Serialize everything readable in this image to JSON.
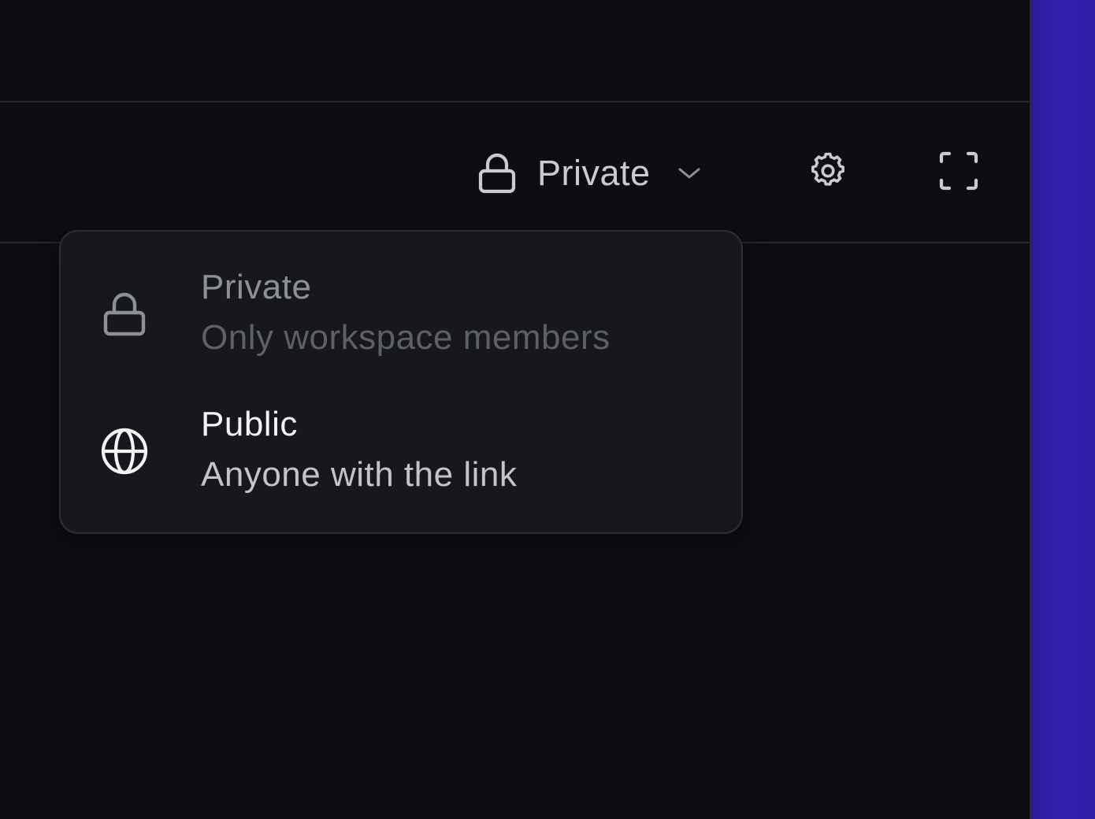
{
  "toolbar": {
    "visibility_label": "Private",
    "visibility_icon": "lock-icon",
    "dropdown_icon": "chevron-down-icon",
    "settings_icon": "gear-icon",
    "fullscreen_icon": "fullscreen-icon"
  },
  "visibility_menu": {
    "items": [
      {
        "title": "Private",
        "description": "Only workspace members",
        "icon": "lock-icon",
        "state": "selected-muted"
      },
      {
        "title": "Public",
        "description": "Anyone with the link",
        "icon": "globe-icon",
        "state": "available"
      }
    ]
  },
  "colors": {
    "background": "#0d0e11",
    "menu_background": "#17181c",
    "menu_border": "#2c2e35",
    "accent_backdrop": "#2f20ab"
  }
}
